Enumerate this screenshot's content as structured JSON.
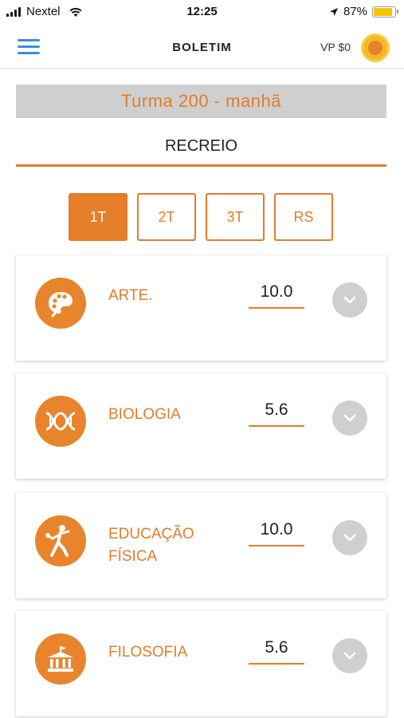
{
  "status": {
    "carrier": "Nextel",
    "time": "12:25",
    "battery": "87%"
  },
  "header": {
    "title": "BOLETIM",
    "vp": "VP $0"
  },
  "class_name": "Turma 200 - manhã",
  "section": "RECREIO",
  "tabs": [
    {
      "label": "1T",
      "active": true
    },
    {
      "label": "2T",
      "active": false
    },
    {
      "label": "3T",
      "active": false
    },
    {
      "label": "RS",
      "active": false
    }
  ],
  "subjects": [
    {
      "name": "ARTE.",
      "grade": "10.0",
      "icon": "palette-icon"
    },
    {
      "name": "BIOLOGIA",
      "grade": "5.6",
      "icon": "dna-icon"
    },
    {
      "name_line1": "EDUCAÇÃO",
      "name_line2": "FÍSICA",
      "grade": "10.0",
      "icon": "discus-thrower-icon"
    },
    {
      "name": "FILOSOFIA",
      "grade": "5.6",
      "icon": "temple-icon"
    }
  ],
  "colors": {
    "accent": "#e07d2a",
    "banner": "#cfcfcf",
    "menu": "#3d8fd6",
    "battery": "#f5c400"
  }
}
